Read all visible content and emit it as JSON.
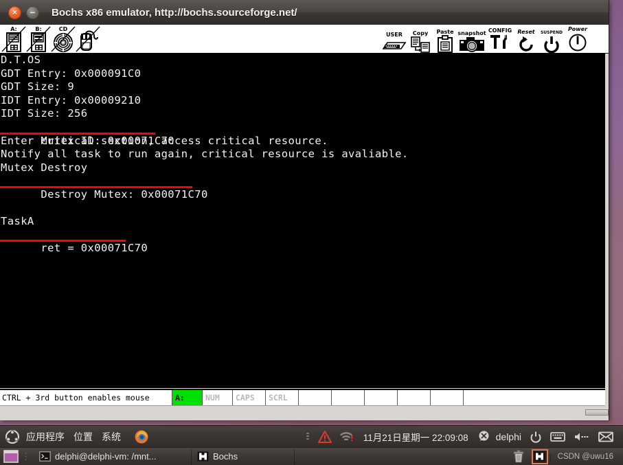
{
  "window": {
    "title": "Bochs x86 emulator, http://bochs.sourceforge.net/",
    "close_label": "×",
    "minimize_label": "−"
  },
  "toolbar": {
    "drives": [
      {
        "label": "A:",
        "icon": "floppy-a-icon",
        "disabled": true
      },
      {
        "label": "B:",
        "icon": "floppy-b-icon",
        "disabled": true
      },
      {
        "label": "CD",
        "icon": "cdrom-icon",
        "disabled": true
      },
      {
        "label": "",
        "icon": "mouse-icon",
        "disabled": true
      }
    ],
    "actions": [
      {
        "label": "USER",
        "icon": "keyboard-icon"
      },
      {
        "label": "Copy",
        "icon": "copy-icon"
      },
      {
        "label": "Paste",
        "icon": "paste-icon"
      },
      {
        "label": "snapshot",
        "icon": "camera-icon"
      },
      {
        "label": "CONFIG",
        "icon": "tools-icon"
      },
      {
        "label": "Reset",
        "icon": "reset-icon"
      },
      {
        "label": "suspend",
        "icon": "suspend-icon"
      },
      {
        "label": "Power",
        "icon": "power-icon"
      }
    ]
  },
  "screen": {
    "lines": [
      {
        "text": "D.T.OS",
        "underline": false
      },
      {
        "text": "GDT Entry: 0x000091C0",
        "underline": false
      },
      {
        "text": "GDT Size: 9",
        "underline": false
      },
      {
        "text": "IDT Entry: 0x00009210",
        "underline": false
      },
      {
        "text": "IDT Size: 256",
        "underline": false
      },
      {
        "text": "Mutex ID: 0x00071C70",
        "underline": true,
        "underline_width": 226
      },
      {
        "text": "Enter critical section, access critical resource.",
        "underline": false
      },
      {
        "text": "Notify all task to run again, critical resource is avaliable.",
        "underline": false
      },
      {
        "text": "Mutex Destroy",
        "underline": false
      },
      {
        "text": "Destroy Mutex: 0x00071C70",
        "underline": true,
        "underline_width": 280
      },
      {
        "text": "",
        "underline": false
      },
      {
        "text": "",
        "underline": false
      },
      {
        "text": "TaskA",
        "underline": false
      },
      {
        "text": "ret = 0x00071C70",
        "underline": true,
        "underline_width": 183
      }
    ]
  },
  "statusbar": {
    "message": "CTRL + 3rd button enables mouse",
    "cells": [
      {
        "label": "A:",
        "active": true
      },
      {
        "label": "NUM",
        "active": false
      },
      {
        "label": "CAPS",
        "active": false
      },
      {
        "label": "SCRL",
        "active": false
      },
      {
        "label": "",
        "active": false
      },
      {
        "label": "",
        "active": false
      },
      {
        "label": "",
        "active": false
      },
      {
        "label": "",
        "active": false
      },
      {
        "label": "",
        "active": false
      },
      {
        "label": "",
        "active": false
      }
    ]
  },
  "panel": {
    "menus": [
      "应用程序",
      "位置",
      "系统"
    ],
    "clock": "11月21日星期一 22:09:08",
    "username": "delphi",
    "tray_icons": [
      "warning-icon",
      "wifi-icon",
      "messaging-icon",
      "power-icon",
      "keyboard-layout-icon",
      "volume-icon",
      "mail-icon"
    ]
  },
  "taskbar": {
    "items": [
      {
        "label": "delphi@delphi-vm: /mnt...",
        "icon": "terminal-icon"
      },
      {
        "label": "Bochs",
        "icon": "bochs-icon"
      }
    ],
    "watermark": "CSDN @uwu16"
  },
  "colors": {
    "screen_bg": "#000000",
    "screen_fg": "#f2f2f2",
    "underline": "#ff0000",
    "status_active": "#00e000",
    "accent": "#e8622b"
  }
}
